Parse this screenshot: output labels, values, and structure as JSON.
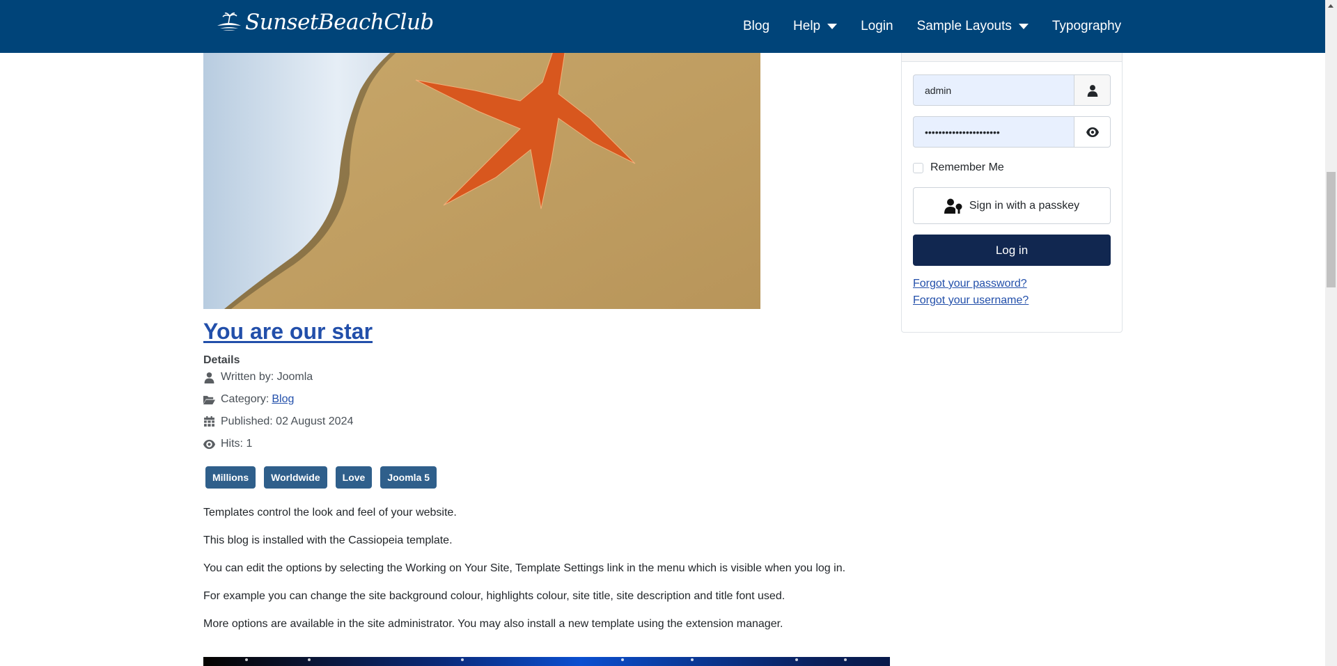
{
  "header": {
    "logo_text": "SunsetBeachClub",
    "nav": [
      {
        "label": "Blog",
        "has_dropdown": false
      },
      {
        "label": "Help",
        "has_dropdown": true
      },
      {
        "label": "Login",
        "has_dropdown": false
      },
      {
        "label": "Sample Layouts",
        "has_dropdown": true
      },
      {
        "label": "Typography",
        "has_dropdown": false
      }
    ],
    "background_color": "#004479"
  },
  "article": {
    "image_alt": "Starfish on beach sand near foamy surf",
    "title": "You are our star",
    "details_label": "Details",
    "meta": {
      "written_by": "Written by: Joomla",
      "category_prefix": "Category:",
      "category_link": "Blog",
      "published": "Published: 02 August 2024",
      "hits": "Hits: 1"
    },
    "tags": [
      "Millions",
      "Worldwide",
      "Love",
      "Joomla 5"
    ],
    "paragraphs": [
      "Templates control the look and feel of your website.",
      "This blog is installed with the Cassiopeia template.",
      "You can edit the options by selecting the Working on Your Site, Template Settings link in the menu which is visible when you log in.",
      "For example you can change the site background colour, highlights colour, site title, site description and title font used.",
      "More options are available in the site administrator. You may also install a new template using the extension manager."
    ]
  },
  "login": {
    "username_value": "admin",
    "password_value": "••••••••••••••••••••••",
    "remember_label": "Remember Me",
    "remember_checked": false,
    "passkey_label": "Sign in with a passkey",
    "login_button": "Log in",
    "forgot_password": "Forgot your password?",
    "forgot_username": "Forgot your username?"
  },
  "colors": {
    "header": "#004479",
    "link": "#224faa",
    "tag": "#2f5f8b",
    "login_button": "#112750"
  }
}
